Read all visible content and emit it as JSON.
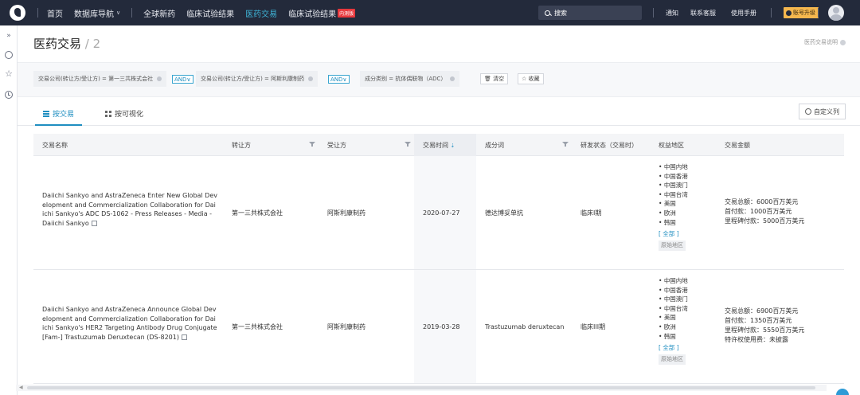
{
  "nav": {
    "items": [
      {
        "label": "首页",
        "active": false,
        "caret": false
      },
      {
        "label": "数据库导航",
        "active": false,
        "caret": true
      },
      {
        "label": "全球新药",
        "active": false,
        "caret": false
      },
      {
        "label": "临床试验结果",
        "active": false,
        "caret": false
      },
      {
        "label": "医药交易",
        "active": true,
        "caret": false
      },
      {
        "label": "临床试验结果",
        "active": false,
        "caret": false
      }
    ],
    "beta_badge": "内测版",
    "search_placeholder": "搜索",
    "right_links": [
      "通知",
      "联系客服",
      "使用手册"
    ],
    "upgrade_label": "账号升级",
    "accent_color": "#3fb5d8"
  },
  "sidebar": {
    "icons": [
      "expand-icon",
      "chat-icon",
      "star-icon",
      "clock-icon"
    ]
  },
  "page": {
    "title": "医药交易",
    "separator": " / ",
    "count": "2",
    "help_label": "医药交易说明"
  },
  "filters": {
    "chips": [
      "交易公司(转让方/受让方) = 第一三共株式会社",
      "交易公司(转让方/受让方) = 阿斯利康制药",
      "成分类别 = 抗体偶联物（ADC）"
    ],
    "logic": [
      "AND∨",
      "AND∨"
    ],
    "clear_label": "清空",
    "collect_label": "收藏"
  },
  "tabs": {
    "by_deal": "按交易",
    "by_visual": "按可视化",
    "custom_columns": "自定义列"
  },
  "table": {
    "headers": {
      "name": "交易名称",
      "assignor": "转让方",
      "assignee": "受让方",
      "date": "交易时间",
      "ingredient": "成分词",
      "status": "研发状态（交易时）",
      "regions": "权益地区",
      "amount": "交易金额"
    },
    "sort_indicator": "⇣",
    "rows": [
      {
        "name": "Daiichi Sankyo and AstraZeneca Enter New Global Development and Commercialization Collaboration for Daiichi Sankyo's ADC DS-1062 - Press Releases - Media - Daiichi Sankyo",
        "assignor": "第一三共株式会社",
        "assignee": "阿斯利康制药",
        "date": "2020-07-27",
        "ingredient": "德达博妥单抗",
        "status": "临床I期",
        "regions": [
          "中国内地",
          "中国香港",
          "中国澳门",
          "中国台湾",
          "美国",
          "欧洲",
          "韩国"
        ],
        "all_label": "[ 全部 ]",
        "orig_label": "原始地区",
        "amounts": [
          "交易总额：6000百万美元",
          "首付款：1000百万美元",
          "里程碑付款：5000百万美元"
        ]
      },
      {
        "name": "Daiichi Sankyo and AstraZeneca Announce Global Development and Commercialization Collaboration for Daiichi Sankyo's HER2 Targeting Antibody Drug Conjugate [Fam-] Trastuzumab Deruxtecan (DS-8201)",
        "assignor": "第一三共株式会社",
        "assignee": "阿斯利康制药",
        "date": "2019-03-28",
        "ingredient": "Trastuzumab deruxtecan",
        "status": "临床III期",
        "regions": [
          "中国内地",
          "中国香港",
          "中国澳门",
          "中国台湾",
          "美国",
          "欧洲",
          "韩国"
        ],
        "all_label": "[ 全部 ]",
        "orig_label": "原始地区",
        "amounts": [
          "交易总额：6900百万美元",
          "首付款：1350百万美元",
          "里程碑付款：5550百万美元",
          "特许权使用费：未披露"
        ]
      }
    ]
  }
}
